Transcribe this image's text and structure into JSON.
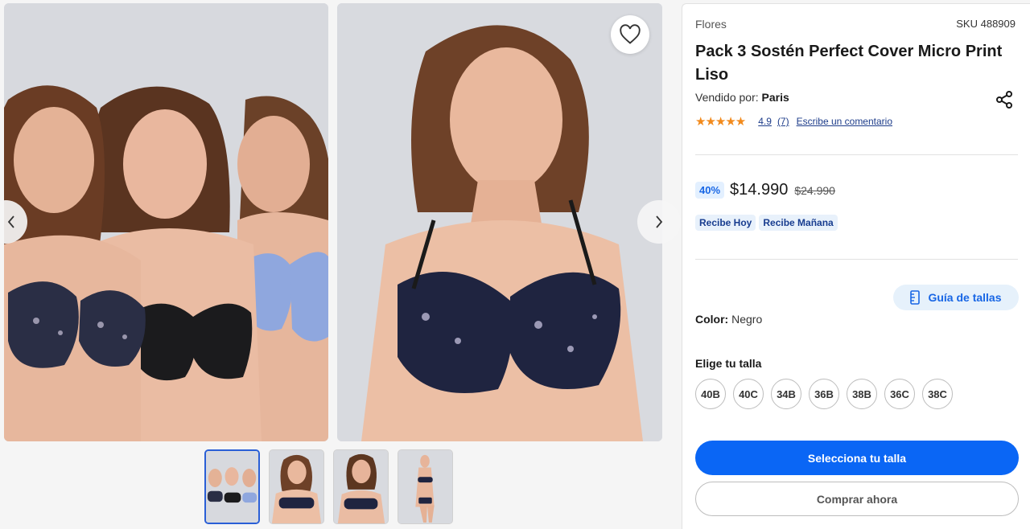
{
  "gallery": {
    "main_images": [
      {
        "alt": "three-models-photo"
      },
      {
        "alt": "single-model-photo"
      }
    ],
    "thumbnails": [
      {
        "id": "thumb-1",
        "active": true
      },
      {
        "id": "thumb-2",
        "active": false
      },
      {
        "id": "thumb-3",
        "active": false
      },
      {
        "id": "thumb-4",
        "active": false
      }
    ],
    "icons": {
      "favorite": "heart-icon",
      "prev": "chevron-left-icon",
      "next": "chevron-right-icon"
    }
  },
  "product": {
    "brand": "Flores",
    "sku": "SKU 488909",
    "title": "Pack 3 Sostén Perfect Cover Micro Print Liso",
    "seller_label": "Vendido por:",
    "seller_name": "Paris",
    "rating_stars": "★★★★★",
    "rating_value": "4.9",
    "rating_count": "(7)",
    "write_review": "Escribe un comentario",
    "discount": "40%",
    "price": "$14.990",
    "old_price": "$24.990",
    "delivery_tags": [
      "Recibe Hoy",
      "Recibe Mañana"
    ],
    "size_guide_label": "Guía de tallas",
    "color_label": "Color:",
    "color_value": "Negro",
    "size_title": "Elige tu talla",
    "sizes": [
      "40B",
      "40C",
      "34B",
      "36B",
      "38B",
      "36C",
      "38C"
    ],
    "primary_button": "Selecciona tu talla",
    "secondary_button": "Comprar ahora"
  },
  "colors": {
    "accent": "#0a66f5",
    "discount_text": "#1866e5",
    "star": "#f28a1c",
    "tag_text": "#173c8f"
  }
}
